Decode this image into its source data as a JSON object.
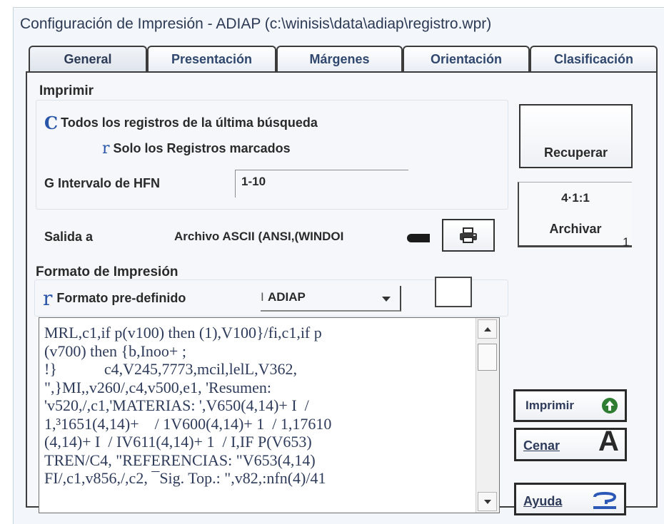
{
  "window": {
    "title": "Configuración de Impresión - ADIAP (c:\\winisis\\data\\adiap\\registro.wpr)"
  },
  "tabs": [
    "General",
    "Presentación",
    "Márgenes",
    "Orientación",
    "Clasificación"
  ],
  "print_group": {
    "title": "Imprimir",
    "option_all": {
      "mark": "C",
      "label": "Todos los registros de la última búsqueda"
    },
    "option_marked": {
      "mark": "r",
      "label": "Solo los Registros marcados"
    },
    "option_range": {
      "mark": "G",
      "label": "Intervalo de HFN",
      "value": "1-10"
    }
  },
  "output": {
    "label": "Salida a",
    "value": "Archivo ASCII (ANSI,(WINDOI"
  },
  "format_group": {
    "title": "Formato de Impresión",
    "predefined_mark": "r",
    "predefined_label": "Formato pre-definido",
    "select_prefix": "I",
    "select_value": "ADIAP",
    "code_lines": [
      "MRL,c1,if p(v100) then (1),V100}/fi,c1,if p",
      "(v700) then {b,Inoo+ ;",
      "!}            c4,V245,7773,mcil,lelL,V362,",
      "\",}MI,,v260/,c4,v500,e1, 'Resumen:",
      "'v520,/,c1,'MATERIAS: ',V650(4,14)+ I  /",
      "1,³1651(4,14)+    / 1V600(4,14)+ 1  / 1,17610",
      "(4,14)+ I  / IV611(4,14)+ 1  / I,IF P(V653)",
      "TREN/C4, \"REFERENCIAS: \"V653(4,14)",
      "FI/,c1,v856,/,c2, ¯Sig. Top.: \",v82,:nfn(4)/41"
    ]
  },
  "buttons": {
    "recuperar": "Recuperar",
    "archivar_top": "4·1:1",
    "archivar": "Archivar",
    "archivar_suffix": "1",
    "imprimir": "Imprimir",
    "cenar": "Cenar",
    "cenar_icon": "A",
    "ayuda": "Ayuda"
  }
}
